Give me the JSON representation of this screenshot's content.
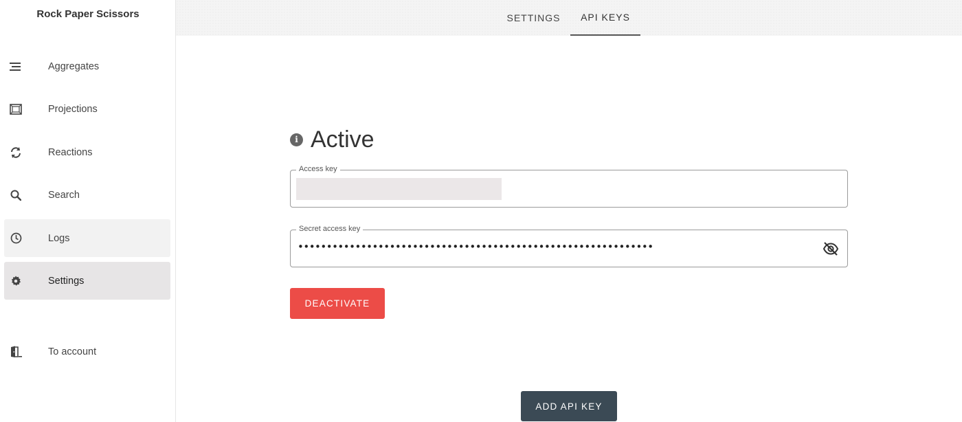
{
  "app": {
    "title": "Rock Paper Scissors"
  },
  "sidebar": {
    "items": [
      {
        "label": "Aggregates",
        "icon": "list-icon"
      },
      {
        "label": "Projections",
        "icon": "projection-icon"
      },
      {
        "label": "Reactions",
        "icon": "refresh-icon"
      },
      {
        "label": "Search",
        "icon": "search-icon"
      },
      {
        "label": "Logs",
        "icon": "clock-icon"
      },
      {
        "label": "Settings",
        "icon": "gear-icon",
        "active": true
      },
      {
        "label": "To account",
        "icon": "door-icon"
      }
    ]
  },
  "tabs": [
    {
      "label": "SETTINGS"
    },
    {
      "label": "API KEYS",
      "active": true
    }
  ],
  "main": {
    "status_heading": "Active",
    "access_key": {
      "label": "Access key",
      "value": ""
    },
    "secret_key": {
      "label": "Secret access key",
      "value": "••••••••••••••••••••••••••••••••••••••••••••••••••••••••••••••"
    },
    "deactivate_label": "DEACTIVATE",
    "add_key_label": "ADD API KEY"
  },
  "colors": {
    "danger": "#ec4c47",
    "primary_dark": "#3b4a55",
    "active_nav": "#e7e5e6"
  }
}
